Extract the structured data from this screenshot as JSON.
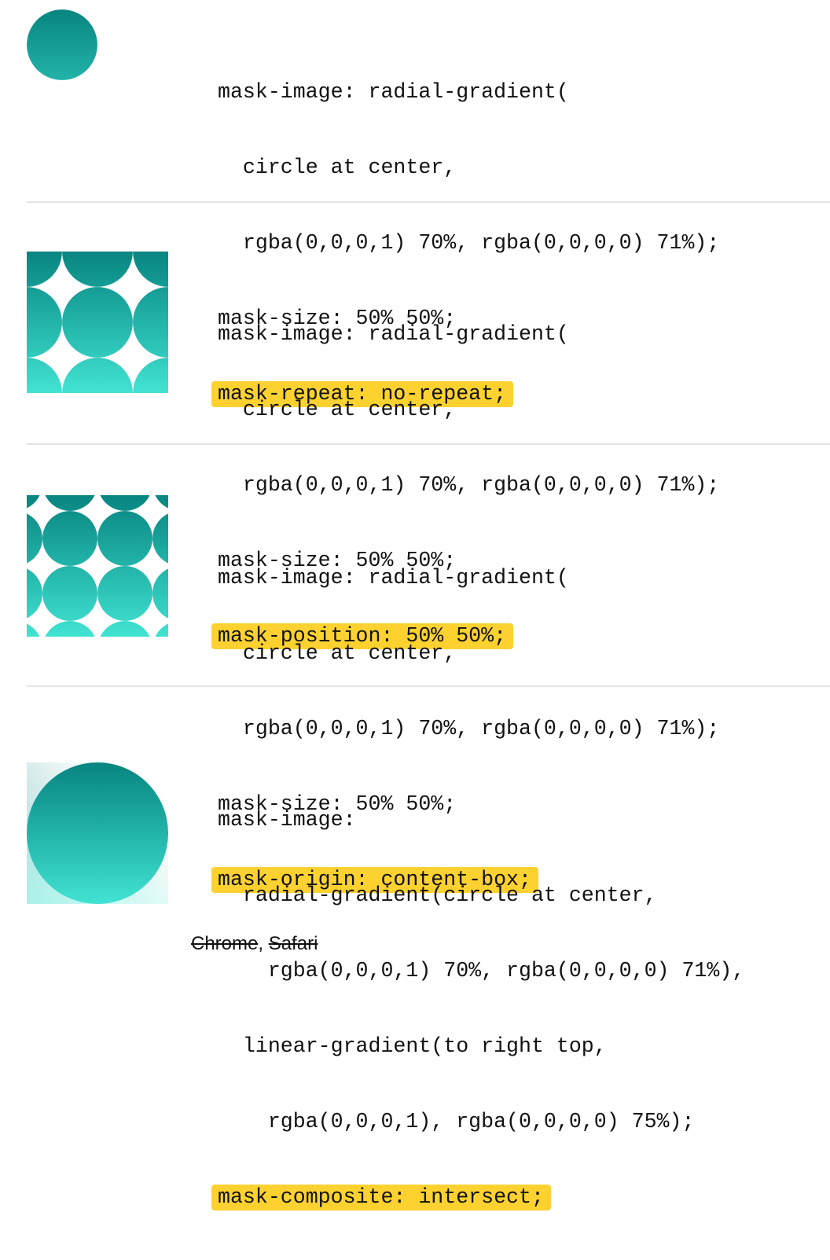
{
  "colors": {
    "gradient_top": "#088580",
    "gradient_bottom": "#42e3d2",
    "highlight": "#fdd230",
    "divider": "#e4e4e4"
  },
  "demos": [
    {
      "preview": "single-circle-mask",
      "lines": [
        "mask-image: radial-gradient(",
        "  circle at center,",
        "  rgba(0,0,0,1) 70%, rgba(0,0,0,0) 71%);",
        "mask-size: 50% 50%;"
      ],
      "highlight": "mask-repeat: no-repeat;"
    },
    {
      "preview": "centered-circle-tile-mask",
      "lines": [
        "mask-image: radial-gradient(",
        "  circle at center,",
        "  rgba(0,0,0,1) 70%, rgba(0,0,0,0) 71%);",
        "mask-size: 50% 50%;"
      ],
      "highlight": "mask-position: 50% 50%;"
    },
    {
      "preview": "content-box-circle-tile-mask",
      "lines": [
        "mask-image: radial-gradient(",
        "  circle at center,",
        "  rgba(0,0,0,1) 70%, rgba(0,0,0,0) 71%);",
        "mask-size: 50% 50%;"
      ],
      "highlight": "mask-origin: content-box;"
    },
    {
      "preview": "intersect-composite-mask",
      "lines": [
        "mask-image:",
        "  radial-gradient(circle at center,",
        "    rgba(0,0,0,1) 70%, rgba(0,0,0,0) 71%),",
        "  linear-gradient(to right top,",
        "    rgba(0,0,0,1), rgba(0,0,0,0) 75%);"
      ],
      "highlight": "mask-composite: intersect;"
    }
  ],
  "support": {
    "browser1": "Chrome",
    "separator": ", ",
    "browser2": "Safari"
  }
}
